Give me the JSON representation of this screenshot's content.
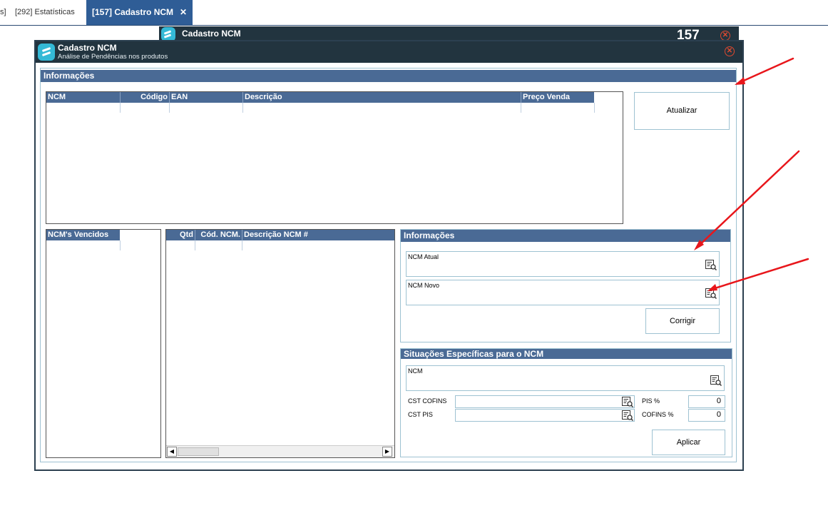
{
  "tabs": [
    {
      "label": "s]"
    },
    {
      "label": "[292] Estatísticas"
    },
    {
      "label": "[157] Cadastro NCM",
      "close": "✕"
    }
  ],
  "background_window": {
    "title": "Cadastro NCM",
    "number": "157"
  },
  "window": {
    "title": "Cadastro NCM",
    "subtitle": "Análise de Pendências nos produtos"
  },
  "info_section": {
    "title": "Informações",
    "columns": [
      "NCM",
      "Código",
      "EAN",
      "Descrição",
      "Preço Venda"
    ],
    "refresh_button": "Atualizar"
  },
  "expired_grid": {
    "columns": [
      "NCM's Vencidos"
    ]
  },
  "ncm_grid": {
    "columns": [
      "Qtd",
      "Cód. NCM.",
      "Descrição NCM #"
    ]
  },
  "correction_panel": {
    "title": "Informações",
    "current_ncm_label": "NCM Atual",
    "new_ncm_label": "NCM Novo",
    "fix_button": "Corrigir"
  },
  "specific_panel": {
    "title": "Situações Específicas para o NCM",
    "ncm_label": "NCM",
    "cst_cofins_label": "CST COFINS",
    "cst_pis_label": "CST PIS",
    "pis_label": "PIS %",
    "pis_value": "0",
    "cofins_label": "COFINS %",
    "cofins_value": "0",
    "apply_button": "Aplicar"
  },
  "colors": {
    "accent": "#2f5d96",
    "header": "#4a6a95",
    "titlebar": "#22343f",
    "annotation_arrow": "#e8161b"
  }
}
